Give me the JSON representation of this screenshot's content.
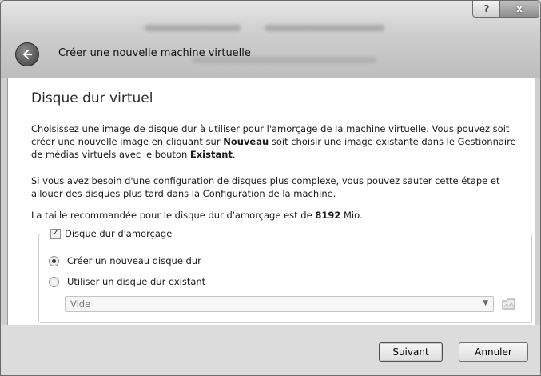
{
  "window": {
    "title_controls": {
      "help": "?",
      "close": "x"
    },
    "wizard_title": "Créer une nouvelle machine virtuelle"
  },
  "page": {
    "title": "Disque dur virtuel",
    "p1": {
      "a": "Choisissez une image de disque dur à utiliser pour l'amorçage de la machine virtuelle. Vous pouvez soit créer une nouvelle image en cliquant sur ",
      "b": "Nouveau",
      "c": " soit choisir une image existante dans le Gestionnaire de médias virtuels avec le bouton ",
      "d": "Existant",
      "e": "."
    },
    "p2": "Si vous avez besoin d'une configuration de disques plus complexe, vous pouvez sauter cette étape et allouer des disques plus tard dans la Configuration de la machine.",
    "p3": {
      "a": "La taille recommandée pour le disque dur d'amorçage est de ",
      "b": "8192",
      "c": " Mio."
    }
  },
  "boot_disk": {
    "checkbox_label": "Disque dur d'amorçage",
    "checked": true,
    "option_new": "Créer un nouveau disque dur",
    "option_existing": "Utiliser un disque dur existant",
    "selected": "new",
    "combo_value": "Vide"
  },
  "buttons": {
    "next": "Suivant",
    "cancel": "Annuler"
  }
}
